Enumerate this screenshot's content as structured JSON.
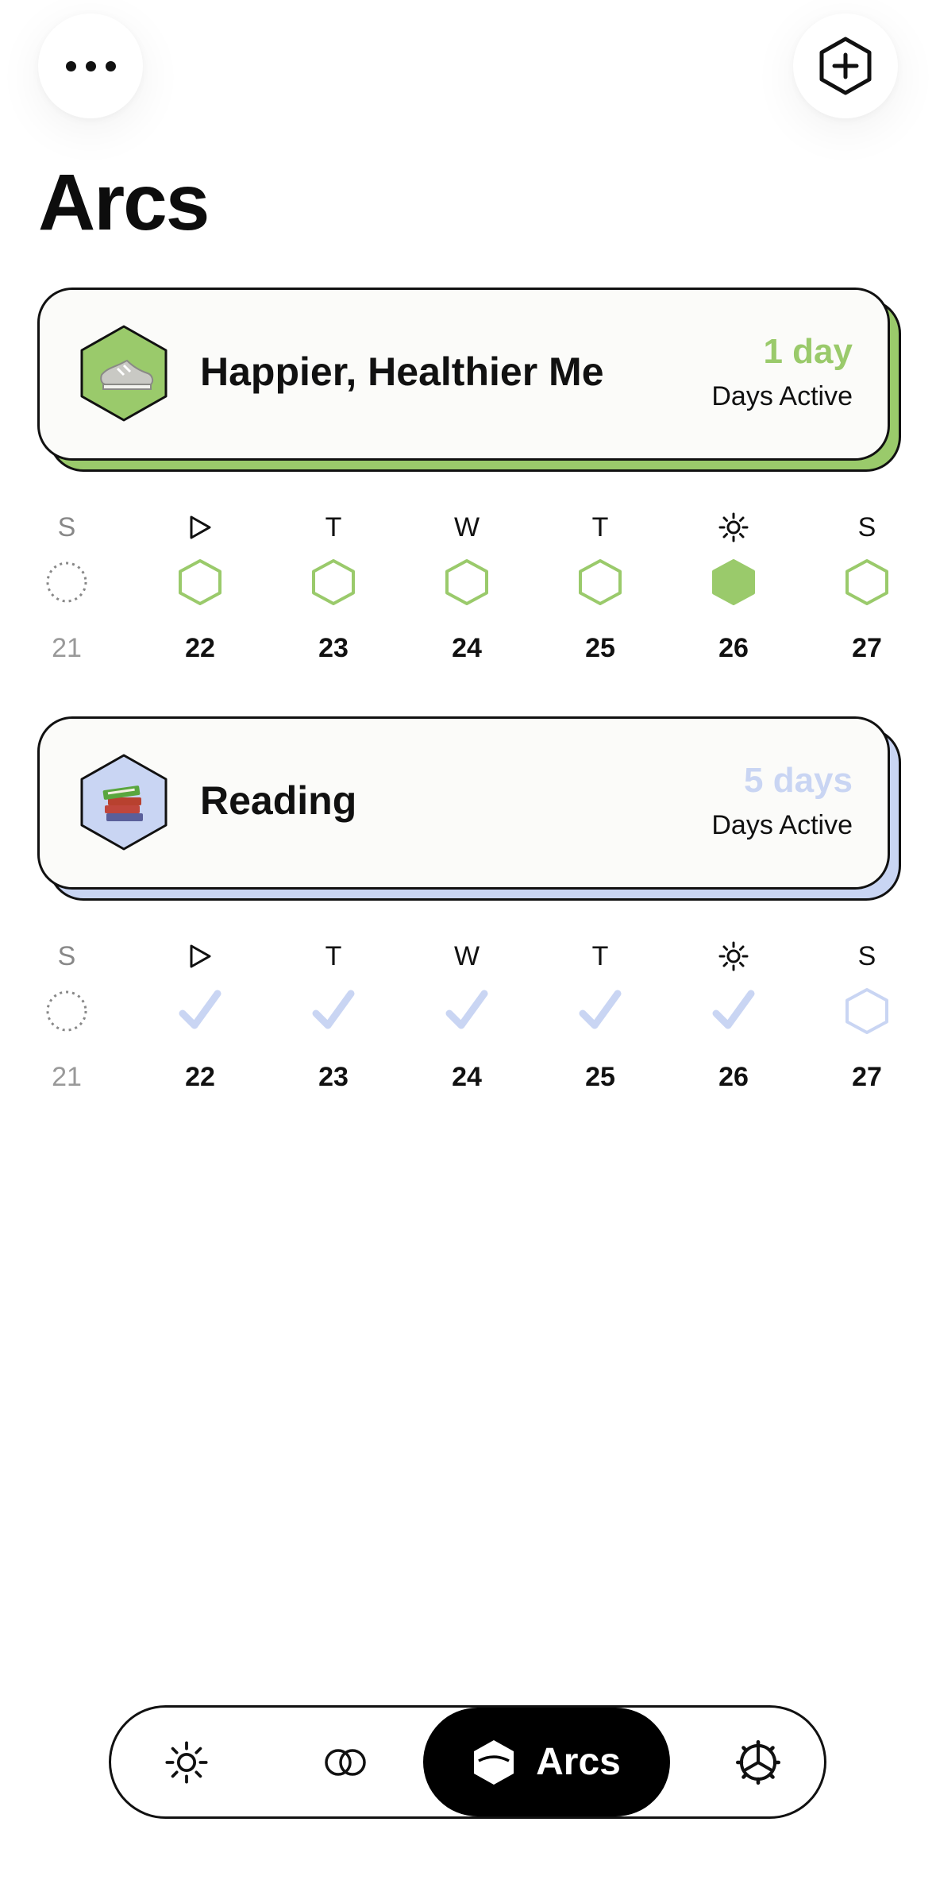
{
  "header": {
    "title": "Arcs",
    "menu_icon": "ellipsis-icon",
    "add_icon": "hexagon-plus-icon"
  },
  "arcs": [
    {
      "name": "Happier, Healthier Me",
      "count": "1 day",
      "sub": "Days Active",
      "color": "#9ACA6B",
      "icon": "sneaker-icon",
      "week": [
        {
          "label": "S",
          "date": "21",
          "status": "pending"
        },
        {
          "label": "▷",
          "date": "22",
          "status": "empty"
        },
        {
          "label": "T",
          "date": "23",
          "status": "empty"
        },
        {
          "label": "W",
          "date": "24",
          "status": "empty"
        },
        {
          "label": "T",
          "date": "25",
          "status": "empty"
        },
        {
          "label": "☼",
          "date": "26",
          "status": "filled"
        },
        {
          "label": "S",
          "date": "27",
          "status": "empty"
        }
      ]
    },
    {
      "name": "Reading",
      "count": "5 days",
      "sub": "Days Active",
      "color": "#C9D5F3",
      "icon": "books-icon",
      "week": [
        {
          "label": "S",
          "date": "21",
          "status": "pending"
        },
        {
          "label": "▷",
          "date": "22",
          "status": "check"
        },
        {
          "label": "T",
          "date": "23",
          "status": "check"
        },
        {
          "label": "W",
          "date": "24",
          "status": "check"
        },
        {
          "label": "T",
          "date": "25",
          "status": "check"
        },
        {
          "label": "☼",
          "date": "26",
          "status": "check"
        },
        {
          "label": "S",
          "date": "27",
          "status": "empty"
        }
      ]
    }
  ],
  "tabbar": {
    "active_label": "Arcs",
    "items": [
      "sun-icon",
      "overlap-circles-icon",
      "arcs-hexagon-icon",
      "gear-icon"
    ]
  }
}
